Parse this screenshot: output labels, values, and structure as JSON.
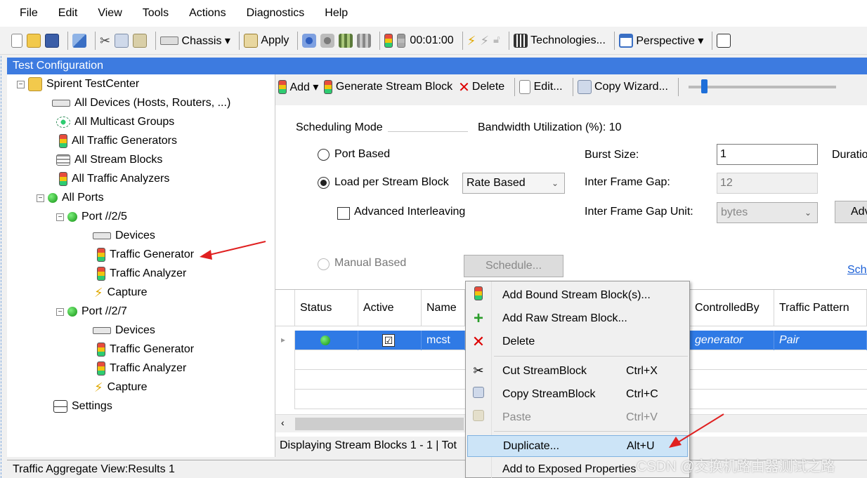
{
  "menubar": {
    "items": [
      "File",
      "Edit",
      "View",
      "Tools",
      "Actions",
      "Diagnostics",
      "Help"
    ]
  },
  "toolbar": {
    "chassis_label": "Chassis ▾",
    "apply_label": "Apply",
    "timer": "00:01:00",
    "technologies_label": "Technologies...",
    "perspective_label": "Perspective ▾"
  },
  "test_config": {
    "title": "Test Configuration"
  },
  "tree": {
    "root": "Spirent TestCenter",
    "all_devices": "All Devices (Hosts, Routers, ...)",
    "all_multicast": "All Multicast Groups",
    "all_traffic_generators": "All Traffic Generators",
    "all_stream_blocks": "All Stream Blocks",
    "all_traffic_analyzers": "All Traffic Analyzers",
    "all_ports": "All Ports",
    "ports": [
      {
        "name": "Port //2/5",
        "devices": "Devices",
        "traffic_generator": "Traffic Generator",
        "traffic_analyzer": "Traffic Analyzer",
        "capture": "Capture"
      },
      {
        "name": "Port //2/7",
        "devices": "Devices",
        "traffic_generator": "Traffic Generator",
        "traffic_analyzer": "Traffic Analyzer",
        "capture": "Capture"
      }
    ],
    "settings": "Settings"
  },
  "stream_toolbar": {
    "add": "Add ▾",
    "generate": "Generate Stream Block",
    "delete": "Delete",
    "edit": "Edit...",
    "copy_wizard": "Copy Wizard..."
  },
  "scheduling": {
    "mode_label": "Scheduling Mode",
    "bandwidth": "Bandwidth Utilization (%): 10",
    "port_based": "Port Based",
    "load_per_stream": "Load per Stream Block",
    "rate_mode": "Rate Based",
    "advanced_interleaving": "Advanced Interleaving",
    "manual_based": "Manual Based",
    "schedule_button": "Schedule...",
    "burst_size_label": "Burst Size:",
    "burst_size_value": "1",
    "duration_label": "Duratio",
    "ifg_label": "Inter Frame Gap:",
    "ifg_value": "12",
    "ifg_unit_label": "Inter Frame Gap Unit:",
    "ifg_unit_value": "bytes",
    "adv_button": "Adv",
    "sche_link": "Sche"
  },
  "grid": {
    "columns": [
      "Status",
      "Active",
      "Name",
      "ControlledBy",
      "Traffic Pattern"
    ],
    "rows": [
      {
        "status": "green",
        "active": "☑",
        "name": "mcst",
        "controlled_by": "generator",
        "traffic_pattern": "Pair"
      }
    ],
    "status_text": "Displaying Stream Blocks 1 - 1  |  Tot"
  },
  "context_menu": {
    "items": [
      {
        "label": "Add Bound Stream Block(s)...",
        "shortcut": ""
      },
      {
        "label": "Add Raw Stream Block...",
        "shortcut": ""
      },
      {
        "label": "Delete",
        "shortcut": ""
      },
      {
        "label": "Cut StreamBlock",
        "shortcut": "Ctrl+X"
      },
      {
        "label": "Copy StreamBlock",
        "shortcut": "Ctrl+C"
      },
      {
        "label": "Paste",
        "shortcut": "Ctrl+V"
      },
      {
        "label": "Duplicate...",
        "shortcut": "Alt+U"
      },
      {
        "label": "Add to Exposed Properties",
        "shortcut": ""
      }
    ]
  },
  "bottom_panel": {
    "title": "Traffic Aggregate View:Results 1"
  },
  "watermark": "CSDN @交换机路由器测试之路",
  "colors": {
    "accent": "#3d7be0",
    "selection": "#2f7ae5",
    "arrow": "#e02020"
  }
}
